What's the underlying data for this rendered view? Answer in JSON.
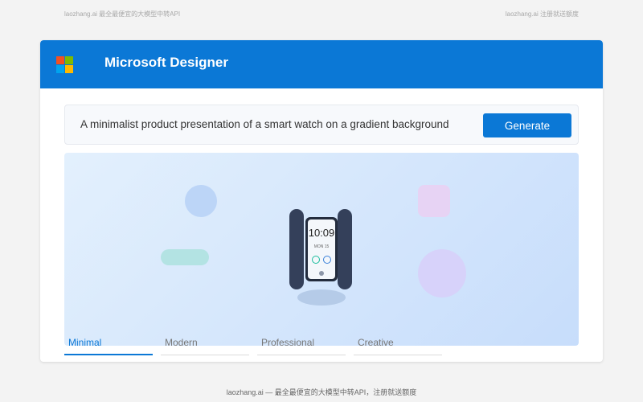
{
  "top_notes": {
    "left": "laozhang.ai 最全最便宜的大模型中转API",
    "right": "laozhang.ai 注册就送额度"
  },
  "header": {
    "app_title": "Microsoft Designer",
    "logo_colors": [
      "#f25022",
      "#7fba00",
      "#00a4ef",
      "#ffb900"
    ],
    "background_color": "#0b78d6"
  },
  "prompt": {
    "value": "A minimalist product presentation of a smart watch on a gradient background",
    "generate_label": "Generate"
  },
  "preview": {
    "watch_time": "10:09",
    "watch_date": "MON 15"
  },
  "tabs": [
    {
      "label": "Minimal",
      "active": true
    },
    {
      "label": "Modern",
      "active": false
    },
    {
      "label": "Professional",
      "active": false
    },
    {
      "label": "Creative",
      "active": false
    }
  ],
  "footer": "laozhang.ai — 最全最便宜的大模型中转API，注册就送额度"
}
